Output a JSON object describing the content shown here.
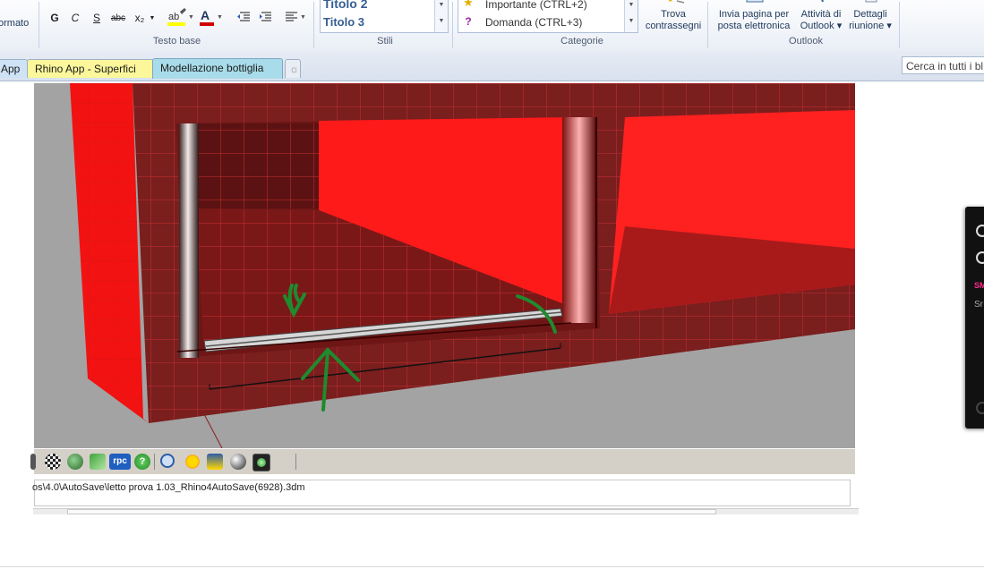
{
  "ribbon": {
    "format_label": "ormato",
    "format_buttons": [
      "G",
      "C",
      "S",
      "abc",
      "x₂"
    ],
    "groups": {
      "testo_base": "Testo base",
      "stili": "Stili",
      "categorie": "Categorie",
      "outlook": "Outlook"
    },
    "styles": [
      "Titolo 2",
      "Titolo 3"
    ],
    "categories": [
      {
        "label": "Importante (CTRL+2)",
        "icon": "star-icon"
      },
      {
        "label": "Domanda (CTRL+3)",
        "icon": "question-icon"
      }
    ],
    "trova": [
      "Trova",
      "contrassegni"
    ],
    "invia": [
      "Invia pagina per",
      "posta elettronica"
    ],
    "attivita": [
      "Attività di",
      "Outlook ▾"
    ],
    "dettagli": [
      "Dettagli",
      "riunione ▾"
    ]
  },
  "tabs": [
    {
      "label": "App",
      "color": "#cfe3f7"
    },
    {
      "label": "Rhino App - Superfici",
      "color": "#fbf79a"
    },
    {
      "label": "Modellazione bottiglia",
      "color": "#a9dcea"
    },
    {
      "label": "☼",
      "color": "#e9eef5"
    }
  ],
  "search": {
    "placeholder": "Cerca in tutti i bl"
  },
  "rhino": {
    "status_path": "os\\4.0\\AutoSave\\letto prova 1.03_Rhino4AutoSave(6928).3dm",
    "toolbar_icons": [
      "render-icon",
      "checker-icon",
      "globe-icon",
      "brush-icon",
      "rpc-label",
      "help-icon",
      "zoom-icon",
      "sun-icon",
      "light-icon",
      "sphere-icon",
      "green-sphere-icon"
    ],
    "rpc": "rpc"
  },
  "overlay": {
    "pink_text": "SM",
    "grey_text": "Sr"
  }
}
